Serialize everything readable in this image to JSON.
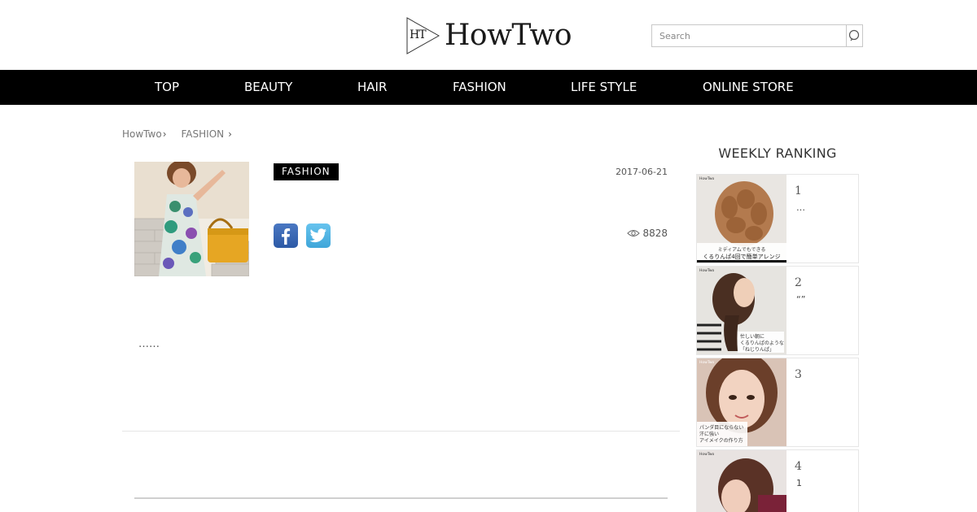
{
  "header": {
    "logo_mark": "HT",
    "logo_text": "HowTwo",
    "search_placeholder": "Search"
  },
  "nav": {
    "items": [
      "TOP",
      "BEAUTY",
      "HAIR",
      "FASHION",
      "LIFE STYLE",
      "ONLINE STORE"
    ]
  },
  "breadcrumb": {
    "items": [
      "HowTwo",
      "FASHION"
    ],
    "separator": "›"
  },
  "article": {
    "category": "FASHION",
    "date": "2017-06-21",
    "views": "8828",
    "excerpt": "……"
  },
  "ranking": {
    "title": "WEEKLY RANKING",
    "items": [
      {
        "rank": "1",
        "title": "…",
        "caption_line1": "ミディアムでもできる",
        "caption_line2": "くるりんぱ4回で簡単アレンジ",
        "thumb_brand": "HowTwo"
      },
      {
        "rank": "2",
        "title": "“”",
        "caption_line1": "忙しい朝に",
        "caption_line2": "くるりんぱのような",
        "caption_line3": "「ねじりんぱ」",
        "thumb_brand": "HowTwo"
      },
      {
        "rank": "3",
        "title": "",
        "caption_line1": "パンダ目にならない",
        "caption_line2": "汗に強い",
        "caption_line3": "アイメイクの作り方",
        "thumb_brand": "HowTwo"
      },
      {
        "rank": "4",
        "title": "1",
        "thumb_brand": "HowTwo"
      }
    ]
  },
  "colors": {
    "nav_bg": "#000000",
    "badge_bg": "#000000",
    "logo_accent": "#c0392b",
    "facebook": "#3b5998",
    "twitter": "#55acee"
  },
  "icons": {
    "search": "search-icon",
    "facebook": "facebook-icon",
    "twitter": "twitter-icon",
    "views": "eye-icon"
  }
}
